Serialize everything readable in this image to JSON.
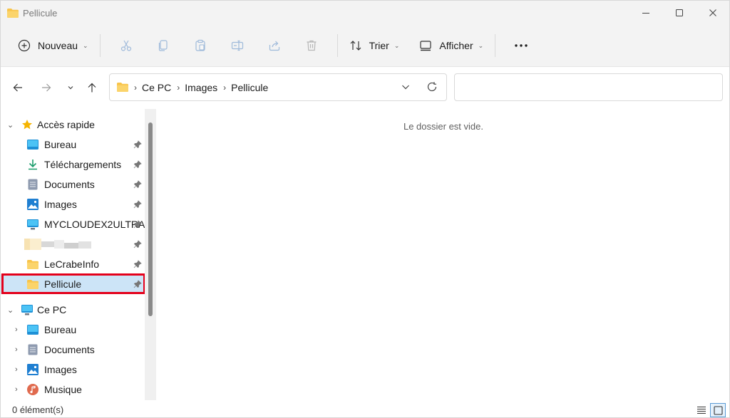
{
  "window": {
    "title": "Pellicule"
  },
  "toolbar": {
    "new_label": "Nouveau",
    "sort_label": "Trier",
    "view_label": "Afficher"
  },
  "address": {
    "crumbs": [
      "Ce PC",
      "Images",
      "Pellicule"
    ],
    "search_placeholder": ""
  },
  "nav": {
    "quick_access": "Accès rapide",
    "quick_items": [
      {
        "label": "Bureau",
        "icon": "desktop-icon"
      },
      {
        "label": "Téléchargements",
        "icon": "download-icon"
      },
      {
        "label": "Documents",
        "icon": "document-icon"
      },
      {
        "label": "Images",
        "icon": "pictures-icon"
      },
      {
        "label": "MYCLOUDEX2ULTRA",
        "icon": "monitor-icon"
      },
      {
        "label": "",
        "icon": "blurred-item"
      },
      {
        "label": "LeCrabeInfo",
        "icon": "folder-icon"
      },
      {
        "label": "Pellicule",
        "icon": "folder-icon"
      }
    ],
    "this_pc": "Ce PC",
    "pc_items": [
      {
        "label": "Bureau",
        "icon": "desktop-icon"
      },
      {
        "label": "Documents",
        "icon": "document-icon"
      },
      {
        "label": "Images",
        "icon": "pictures-icon"
      },
      {
        "label": "Musique",
        "icon": "music-icon"
      }
    ]
  },
  "content": {
    "empty_message": "Le dossier est vide."
  },
  "status": {
    "item_count": "0 élément(s)"
  },
  "colors": {
    "selection": "#cce4f7",
    "highlight_box": "#e4001b",
    "folder": "#f8c44a"
  }
}
